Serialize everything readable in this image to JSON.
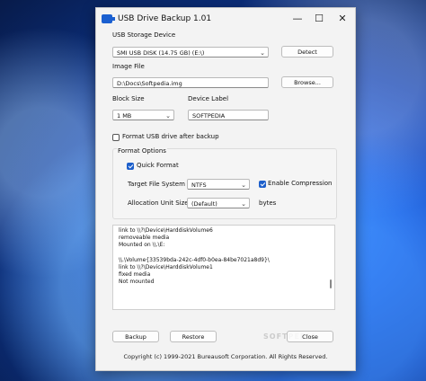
{
  "window": {
    "title": "USB Drive Backup 1.01",
    "controls": {
      "minimize": "—",
      "maximize": "☐",
      "close": "✕"
    }
  },
  "storage": {
    "label": "USB Storage Device",
    "selected": "SMI USB DISK (14.75 GB) (E:\\)",
    "detect_button": "Detect"
  },
  "image": {
    "label": "Image File",
    "value": "D:\\Docs\\Softpedia.img",
    "browse_button": "Browse..."
  },
  "block": {
    "label": "Block Size",
    "selected": "1 MB"
  },
  "device_label": {
    "label": "Device Label",
    "value": "SOFTPEDIA"
  },
  "format_checkbox": {
    "label": "Format USB drive after backup",
    "checked": false
  },
  "format_options": {
    "title": "Format Options",
    "quick_format": {
      "label": "Quick Format",
      "checked": true
    },
    "fs_label": "Target File System",
    "fs_value": "NTFS",
    "compression": {
      "label": "Enable Compression",
      "checked": true
    },
    "alloc_label": "Allocation Unit Size",
    "alloc_value": "(Default)",
    "alloc_unit": "bytes"
  },
  "log": {
    "lines": [
      "link to \\\\?\\Device\\HarddiskVolume6",
      "removeable media",
      "Mounted on \\\\.\\E:",
      "",
      "\\\\.\\Volume{33539bda-242c-4df0-b0ea-84be7021a8d9}\\",
      "link to \\\\?\\Device\\HarddiskVolume1",
      "fixed media",
      "Not mounted"
    ]
  },
  "actions": {
    "backup": "Backup",
    "restore": "Restore",
    "close": "Close"
  },
  "watermark": "SOFTPEDIA",
  "footer": "Copyright (c) 1999-2021 Bureausoft Corporation. All Rights Reserved."
}
